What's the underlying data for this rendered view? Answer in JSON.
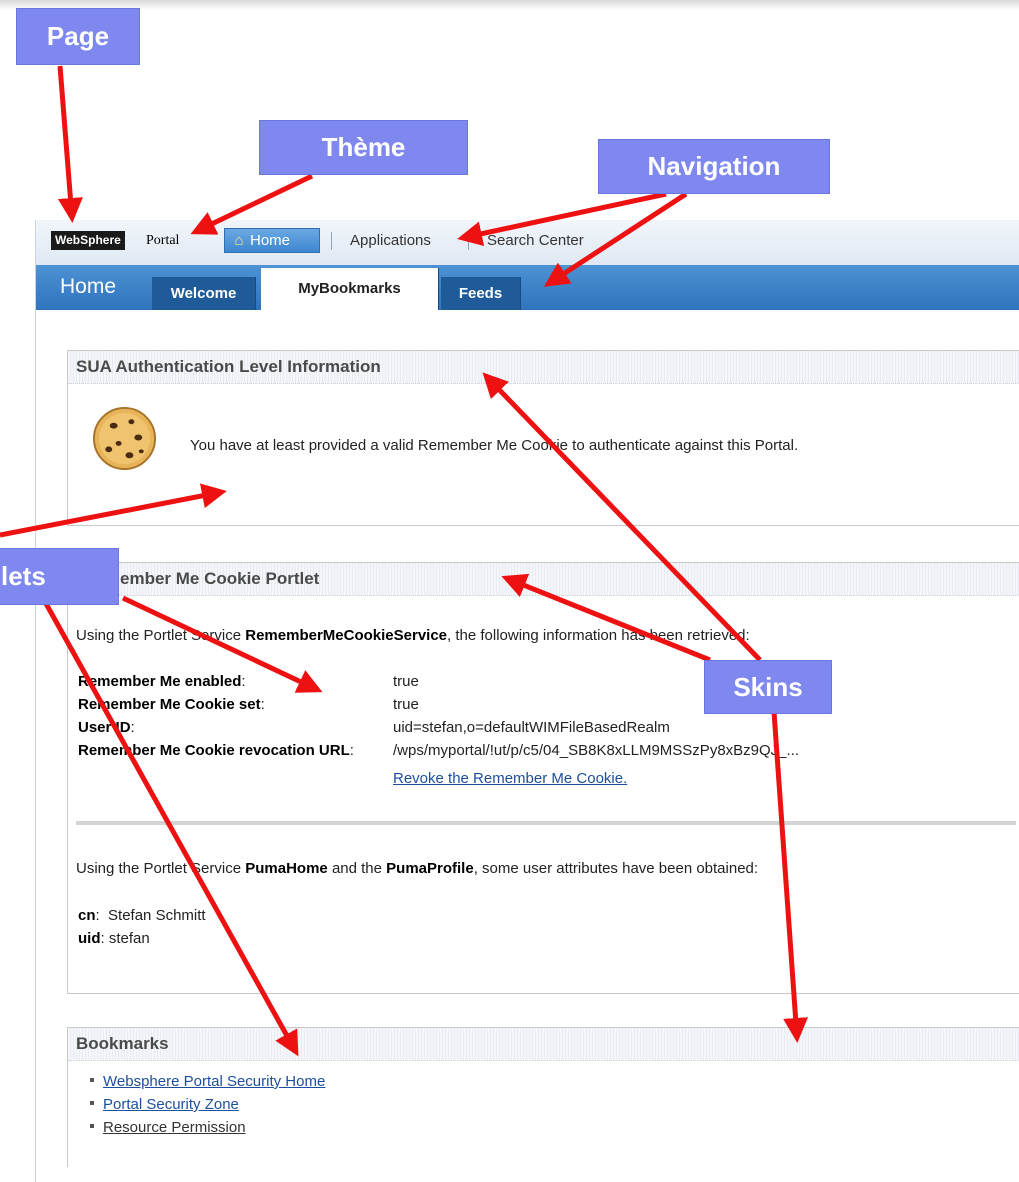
{
  "annotations": {
    "page": "Page",
    "theme": "Thème",
    "navigation": "Navigation",
    "portlets": "lets",
    "skins": "Skins"
  },
  "header": {
    "logo": "WebSphere",
    "product": "Portal",
    "nav": {
      "home": "Home",
      "applications": "Applications",
      "search_center": "Search Center"
    }
  },
  "tabs": {
    "page_title": "Home",
    "items": [
      "Welcome",
      "MyBookmarks",
      "Feeds"
    ],
    "active": "MyBookmarks"
  },
  "portlet_sua": {
    "title": "SUA Authentication Level Information",
    "message": "You have at least provided a valid Remember Me Cookie to authenticate against this Portal."
  },
  "portlet_rmc": {
    "title": "ember Me Cookie Portlet",
    "intro_prefix": "Using the Portlet Service ",
    "intro_service": "RememberMeCookieService",
    "intro_suffix": ", the following information has been retrieved:",
    "rows": [
      {
        "label": "Remember Me enabled",
        "value": "true"
      },
      {
        "label": "Remember Me Cookie set",
        "value": "true"
      },
      {
        "label": "User ID",
        "value": "uid=stefan,o=defaultWIMFileBasedRealm"
      },
      {
        "label": "Remember Me Cookie revocation URL",
        "value": "/wps/myportal/!ut/p/c5/04_SB8K8xLLM9MSSzPy8xBz9QJ_..."
      }
    ],
    "revoke_link": "Revoke the Remember Me Cookie.",
    "puma_prefix": "Using the Portlet Service ",
    "puma_home": "PumaHome",
    "puma_and": " and the ",
    "puma_profile": "PumaProfile",
    "puma_suffix": ", some user attributes have been obtained:",
    "attrs": [
      {
        "label": "cn",
        "value": "Stefan Schmitt"
      },
      {
        "label": "uid",
        "value": "stefan"
      }
    ]
  },
  "portlet_bookmarks": {
    "title": "Bookmarks",
    "items": [
      "Websphere Portal Security Home",
      "Portal Security Zone",
      "Resource Permission"
    ]
  },
  "colors": {
    "annotation_bg": "#7f88ee",
    "arrow": "#ee1111",
    "tabbar": "#3a80c8"
  }
}
